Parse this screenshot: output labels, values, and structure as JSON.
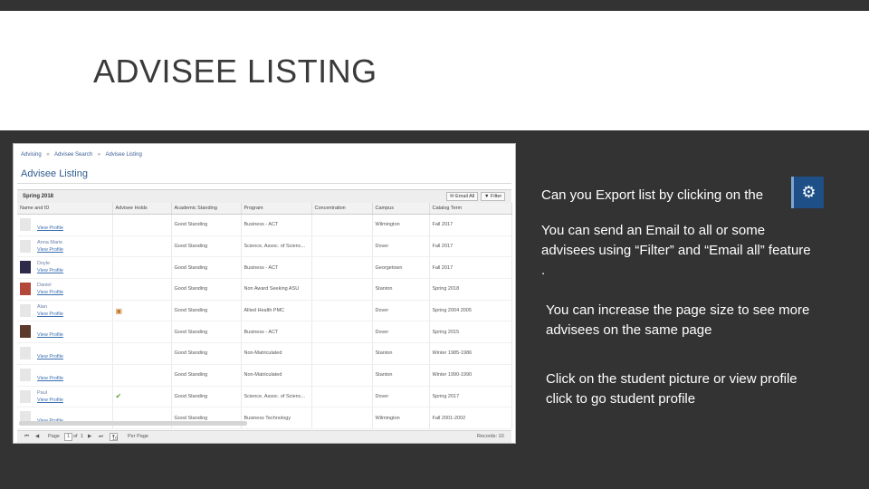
{
  "slide": {
    "title": "ADVISEE LISTING"
  },
  "screenshot": {
    "breadcrumb": [
      "Advising",
      "Advisee Search",
      "Advisee Listing"
    ],
    "page_heading": "Advisee Listing",
    "toolbar": {
      "term": "Spring 2018",
      "email_all_label": "Email All",
      "filter_label": "Filter"
    },
    "columns": [
      "Name and ID",
      "Advisee Holds",
      "Academic Standing",
      "Program",
      "Concentration",
      "Campus",
      "Catalog Term"
    ],
    "rows": [
      {
        "name": "",
        "view": "View Profile",
        "hold": "",
        "standing": "Good Standing",
        "program": "Business - ACT",
        "concentration": "",
        "campus": "Wilmington",
        "term": "Fall 2017",
        "pic": "light"
      },
      {
        "name": "Anna Marie",
        "view": "View Profile",
        "hold": "",
        "standing": "Good Standing",
        "program": "Science, Assoc. of Scienc...",
        "concentration": "",
        "campus": "Dover",
        "term": "Fall 2017",
        "pic": "light"
      },
      {
        "name": "Doyle",
        "view": "View Profile",
        "hold": "",
        "standing": "Good Standing",
        "program": "Business - ACT",
        "concentration": "",
        "campus": "Georgetown",
        "term": "Fall 2017",
        "pic": "dark"
      },
      {
        "name": "Daniel",
        "view": "View Profile",
        "hold": "",
        "standing": "Good Standing",
        "program": "Non Award Seeking ASU",
        "concentration": "",
        "campus": "Stanton",
        "term": "Spring 2018",
        "pic": "red"
      },
      {
        "name": "Alan",
        "view": "View Profile",
        "hold": "hold",
        "standing": "Good Standing",
        "program": "Allied Health PMC",
        "concentration": "",
        "campus": "Dover",
        "term": "Spring 2004 2005",
        "pic": "light"
      },
      {
        "name": "",
        "view": "View Profile",
        "hold": "",
        "standing": "Good Standing",
        "program": "Business - ACT",
        "concentration": "",
        "campus": "Dover",
        "term": "Spring 2015",
        "pic": "brown"
      },
      {
        "name": "",
        "view": "View Profile",
        "hold": "",
        "standing": "Good Standing",
        "program": "Non-Matriculated",
        "concentration": "",
        "campus": "Stanton",
        "term": "Winter 1985-1986",
        "pic": "light"
      },
      {
        "name": "",
        "view": "View Profile",
        "hold": "",
        "standing": "Good Standing",
        "program": "Non-Matriculated",
        "concentration": "",
        "campus": "Stanton",
        "term": "Winter 1990-1990",
        "pic": "light"
      },
      {
        "name": "Paul",
        "view": "View Profile",
        "hold": "check",
        "standing": "Good Standing",
        "program": "Science, Assoc. of Scienc...",
        "concentration": "",
        "campus": "Dover",
        "term": "Spring 2017",
        "pic": "light"
      },
      {
        "name": "",
        "view": "View Profile",
        "hold": "",
        "standing": "Good Standing",
        "program": "Business Technology",
        "concentration": "",
        "campus": "Wilmington",
        "term": "Fall 2001-2002",
        "pic": "light"
      }
    ],
    "pager": {
      "page_label": "Page",
      "page_value": "1",
      "of_label": "of",
      "page_total": "1",
      "page_size": "10",
      "per_page_label": "Per Page",
      "records_label": "Records: 10"
    }
  },
  "notes": {
    "export": "Can you Export list by clicking on the",
    "email": "You can send an Email to all or some advisees using “Filter” and “Email all” feature .",
    "page_size": "You can increase the page size to see more advisees on the same page",
    "profile": "Click on the student picture or view profile click to go student profile"
  },
  "icons": {
    "export": "gear-icon",
    "hold": "hold-icon",
    "check": "check-icon"
  },
  "colors": {
    "background": "#333333",
    "title_band": "#ffffff",
    "gear_button": "#1e4f86",
    "link": "#3a6fb0"
  }
}
